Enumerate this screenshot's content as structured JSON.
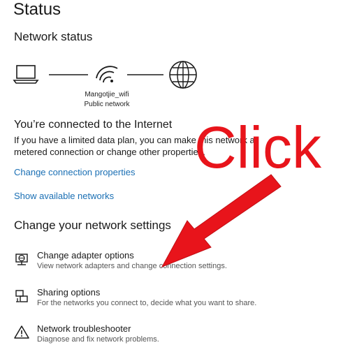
{
  "page_title": "Status",
  "network_status": {
    "heading": "Network status",
    "network_name": "Mangotjie_wifi",
    "network_type": "Public network",
    "icons": [
      "laptop-icon",
      "wifi-icon",
      "globe-icon"
    ]
  },
  "connection": {
    "title": "You’re connected to the Internet",
    "description": "If you have a limited data plan, you can make this network a metered connection or change other properties."
  },
  "links": {
    "change_properties": "Change connection properties",
    "show_networks": "Show available networks"
  },
  "settings": {
    "heading": "Change your network settings",
    "items": [
      {
        "icon": "adapter-icon",
        "title": "Change adapter options",
        "description": "View network adapters and change connection settings."
      },
      {
        "icon": "sharing-icon",
        "title": "Sharing options",
        "description": "For the networks you connect to, decide what you want to share."
      },
      {
        "icon": "warning-icon",
        "title": "Network troubleshooter",
        "description": "Diagnose and fix network problems."
      }
    ]
  },
  "annotation": {
    "text": "Click",
    "color": "#e8141b"
  },
  "colors": {
    "link": "#1a6fb4",
    "text": "#1a1a1a",
    "secondary_text": "#555555"
  }
}
